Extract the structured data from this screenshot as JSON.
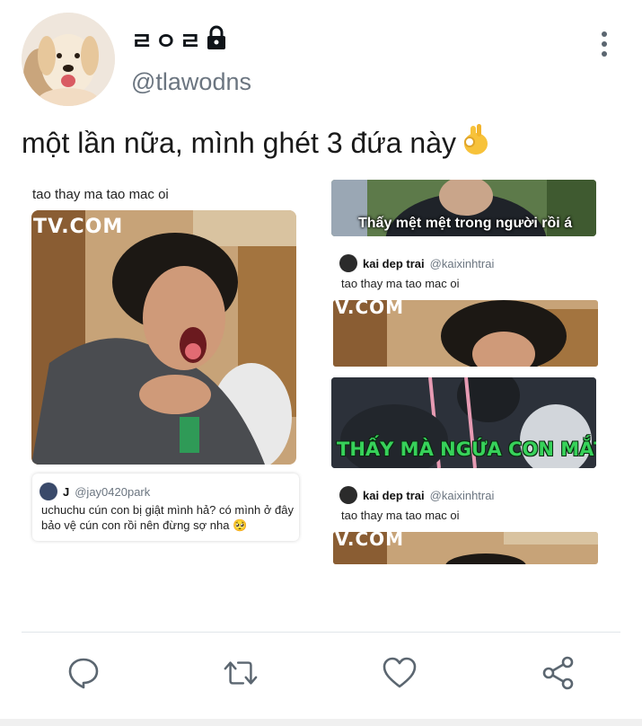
{
  "profile": {
    "display_name": "ㄹㅇㄹ",
    "handle": "@tlawodns",
    "avatar_icon": "dog-avatar",
    "lock_icon": "lock-icon"
  },
  "tweet": {
    "text": "một lần nữa, mình ghét 3 đứa này",
    "emoji_icon": "ok-hand-emoji"
  },
  "meme_left": {
    "caption": "tao thay ma tao mac oi",
    "watermark": "TV.COM",
    "reply": {
      "name": "J",
      "handle": "@jay0420park",
      "text_line1": "uchuchu cún con bị giật mình hả? có mình ở đây",
      "text_line2": "bảo vệ cún con rồi nên đừng sợ nha 🥺"
    }
  },
  "meme_right": {
    "top_caption": "Thấy mệt mệt trong người rồi á",
    "reply1": {
      "name": "kai dep trai",
      "handle": "@kaixinhtrai",
      "text": "tao thay ma tao mac oi"
    },
    "watermark1": "V.COM",
    "green_caption": "THẤY MÀ NGỨA CON MẮT",
    "reply2": {
      "name": "kai dep trai",
      "handle": "@kaixinhtrai",
      "text": "tao thay ma tao mac oi"
    },
    "watermark2": "V.COM"
  },
  "actions": [
    {
      "icon": "reply-icon"
    },
    {
      "icon": "retweet-icon"
    },
    {
      "icon": "like-icon"
    },
    {
      "icon": "share-icon"
    }
  ],
  "colors": {
    "icon_gray": "#5b6670",
    "green_caption": "#37d25a"
  }
}
